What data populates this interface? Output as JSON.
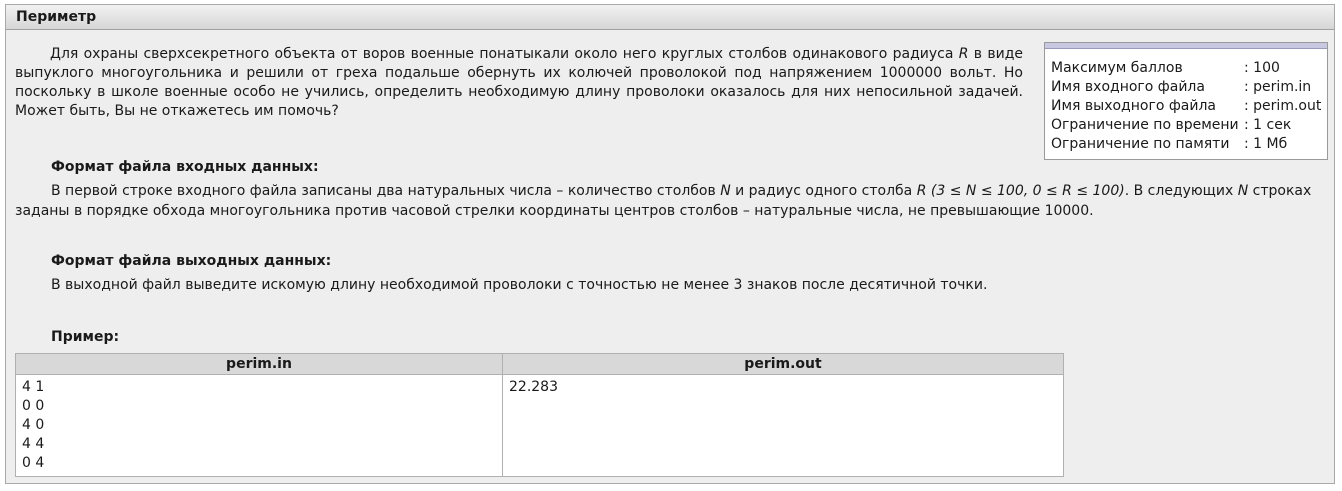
{
  "title": "Периметр",
  "intro": {
    "part1": "Для охраны сверхсекретного объекта от воров военные понатыкали около него круглых столбов одинакового радиуса ",
    "R": "R",
    "part2": " в виде выпуклого многоугольника и решили от греха подальше обернуть их колючей проволокой под напряжением 1000000 вольт. Но поскольку в школе военные особо не учились, определить необходимую длину проволоки оказалось для них непосильной задачей. Может быть, Вы не откажетесь им помочь?"
  },
  "info": [
    {
      "label": "Максимум баллов",
      "value": ": 100"
    },
    {
      "label": "Имя входного файла",
      "value": ": perim.in"
    },
    {
      "label": "Имя выходного файла",
      "value": ": perim.out"
    },
    {
      "label": "Ограничение по времени",
      "value": ": 1 сек"
    },
    {
      "label": "Ограничение по памяти",
      "value": ": 1 Мб"
    }
  ],
  "input_format": {
    "title": "Формат файла входных данных:",
    "p1": "В первой строке входного файла записаны два натуральных числа – количество столбов ",
    "N1": "N",
    "p2": " и радиус одного столба ",
    "R": "R",
    "constraints": " (3 ≤ N ≤ 100, 0 ≤ R ≤ 100)",
    "p3": ". В следующих ",
    "N2": "N",
    "p4": " строках заданы в порядке обхода многоугольника против часовой стрелки координаты центров столбов – натуральные числа, не превышающие 10000."
  },
  "output_format": {
    "title": "Формат файла выходных данных:",
    "text": "В выходной файл выведите искомую длину необходимой проволоки с точностью не менее 3 знаков после десятичной точки."
  },
  "example": {
    "title": "Пример:",
    "in_header": "perim.in",
    "out_header": "perim.out",
    "in_content": "4 1\n0 0\n4 0\n4 4\n0 4",
    "out_content": "22.283"
  }
}
